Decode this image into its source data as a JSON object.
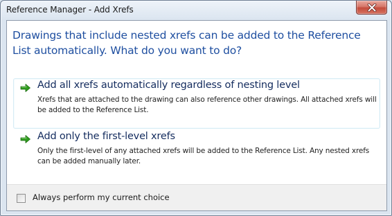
{
  "window": {
    "title": "Reference Manager - Add Xrefs"
  },
  "instruction": "Drawings that include nested xrefs can be added to the Reference List automatically. What do you want to do?",
  "options": [
    {
      "title": "Add all xrefs automatically regardless of nesting level",
      "description": "Xrefs that are attached to the drawing can also reference other drawings. All attached xrefs will be added to the Reference List."
    },
    {
      "title": "Add only the first-level xrefs",
      "description": "Only the first-level of any attached xrefs will be added to the Reference List.  Any nested xrefs can be added manually later."
    }
  ],
  "footer": {
    "checkbox_label": "Always perform my current choice",
    "checkbox_checked": false
  },
  "colors": {
    "instruction_text": "#1f4fa0",
    "option_title": "#142c5e",
    "arrow_green": "#2f9b1f",
    "close_button": "#c44c3c"
  },
  "icons": {
    "close": "close-icon",
    "option_arrow": "green-arrow-icon"
  }
}
